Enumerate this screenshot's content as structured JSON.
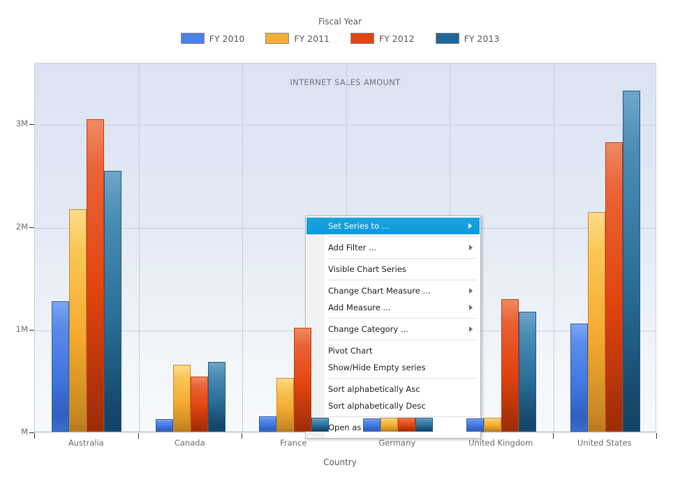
{
  "legend": {
    "title": "Fiscal Year",
    "items": [
      {
        "label": "FY 2010",
        "color": "#4a80e8"
      },
      {
        "label": "FY 2011",
        "color": "#f4b034"
      },
      {
        "label": "FY 2012",
        "color": "#e2440f"
      },
      {
        "label": "FY 2013",
        "color": "#1f6699"
      }
    ]
  },
  "axes": {
    "x_title": "Country",
    "y_ticks": [
      "3M",
      "2M",
      "1M",
      "M"
    ]
  },
  "context_menu": {
    "items": [
      {
        "label": "Set Series to ...",
        "submenu": true,
        "selected": true,
        "separator_after": true
      },
      {
        "label": "Add Filter ...",
        "submenu": true,
        "selected": false,
        "separator_after": true
      },
      {
        "label": "Visible Chart Series",
        "submenu": false,
        "selected": false,
        "separator_after": true
      },
      {
        "label": "Change Chart Measure ...",
        "submenu": true,
        "selected": false,
        "separator_after": false
      },
      {
        "label": "Add Measure ...",
        "submenu": true,
        "selected": false,
        "separator_after": true
      },
      {
        "label": "Change Category ...",
        "submenu": true,
        "selected": false,
        "separator_after": true
      },
      {
        "label": "Pivot Chart",
        "submenu": false,
        "selected": false,
        "separator_after": false
      },
      {
        "label": "Show/Hide Empty series",
        "submenu": false,
        "selected": false,
        "separator_after": true
      },
      {
        "label": "Sort alphabetically Asc",
        "submenu": false,
        "selected": false,
        "separator_after": false
      },
      {
        "label": "Sort alphabetically Desc",
        "submenu": false,
        "selected": false,
        "separator_after": true
      },
      {
        "label": "Open as PDF",
        "submenu": false,
        "selected": false,
        "separator_after": false
      }
    ]
  },
  "chart_data": {
    "type": "bar",
    "title": "INTERNET SALES AMOUNT",
    "xlabel": "Country",
    "ylabel": "",
    "legend_title": "Fiscal Year",
    "legend_position": "top",
    "grid": true,
    "ylim": [
      0,
      3600000
    ],
    "ytick_values": [
      0,
      1000000,
      2000000,
      3000000
    ],
    "ytick_labels": [
      "M",
      "1M",
      "2M",
      "3M"
    ],
    "categories": [
      "Australia",
      "Canada",
      "France",
      "Germany",
      "United Kingdom",
      "United States"
    ],
    "series": [
      {
        "name": "FY 2010",
        "color": "#4a80e8",
        "values": [
          1270000,
          120000,
          150000,
          130000,
          130000,
          1050000
        ]
      },
      {
        "name": "FY 2011",
        "color": "#f4b034",
        "values": [
          2170000,
          650000,
          525000,
          135000,
          135000,
          2140000
        ]
      },
      {
        "name": "FY 2012",
        "color": "#e2440f",
        "values": [
          3040000,
          540000,
          1010000,
          135000,
          1290000,
          2820000
        ]
      },
      {
        "name": "FY 2013",
        "color": "#1f6699",
        "values": [
          2540000,
          680000,
          135000,
          135000,
          1170000,
          3320000
        ]
      }
    ]
  }
}
